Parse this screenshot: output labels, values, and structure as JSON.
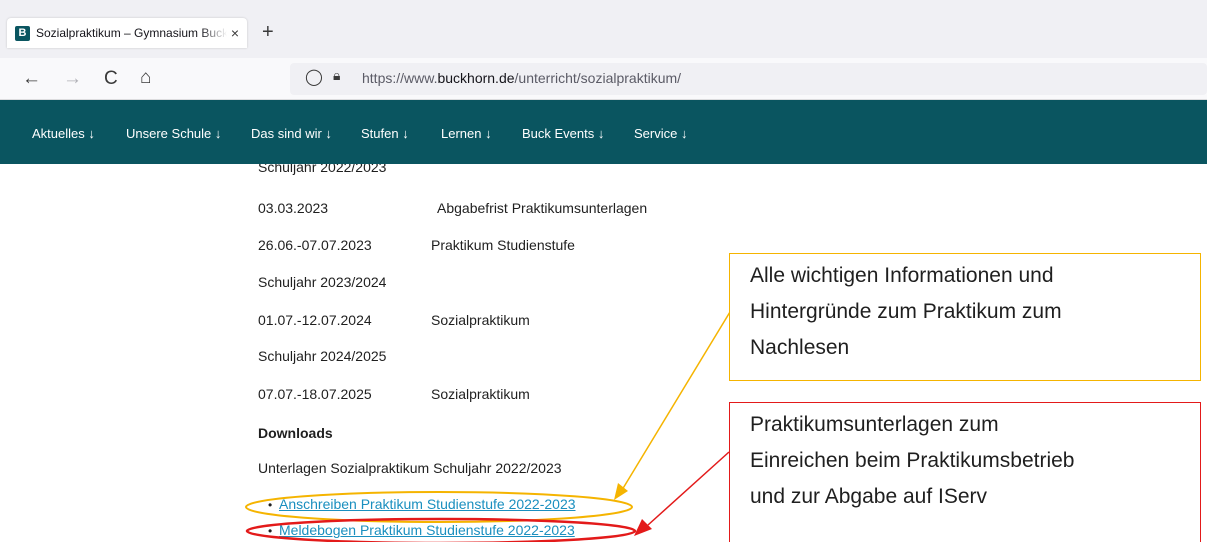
{
  "browser": {
    "tab_title": "Sozialpraktikum – Gymnasium Buckhorn",
    "favicon_letter": "B",
    "tab_close": "×",
    "new_tab": "+",
    "back_icon": "←",
    "forward_icon": "→",
    "reload_icon": "C",
    "home_icon": "⌂",
    "shield_icon": "◯",
    "lock_icon": "🔒︎",
    "url_prefix": "https://www.",
    "url_domain": "buckhorn.de",
    "url_path": "/unterricht/sozialpraktikum/"
  },
  "site_nav": {
    "items": [
      "Aktuelles ↓",
      "Unsere Schule ↓",
      "Das sind wir ↓",
      "Stufen ↓",
      "Lernen ↓",
      "Buck Events ↓",
      "Service ↓"
    ]
  },
  "content": {
    "partial_heading": "Schuljahr 2022/2023",
    "rows": [
      {
        "date": "03.03.2023",
        "text": "Abgabefrist Praktikumsunterlagen"
      },
      {
        "date": "26.06.-07.07.2023",
        "text": "Praktikum Studienstufe"
      },
      {
        "heading": "Schuljahr 2023/2024"
      },
      {
        "date": "01.07.-12.07.2024",
        "text": "Sozialpraktikum"
      },
      {
        "heading": "Schuljahr 2024/2025"
      },
      {
        "date": "07.07.-18.07.2025",
        "text": "Sozialpraktikum"
      }
    ],
    "downloads_heading": "Downloads",
    "downloads_subheading": "Unterlagen Sozialpraktikum Schuljahr 2022/2023",
    "links": [
      "Anschreiben Praktikum Studienstufe 2022-2023",
      "Meldebogen Praktikum Studienstufe 2022-2023"
    ]
  },
  "annotations": {
    "yellow_callout": [
      "Alle wichtigen Informationen und",
      "Hintergründe zum Praktikum zum",
      "Nachlesen"
    ],
    "red_callout": [
      "Praktikumsunterlagen zum",
      "Einreichen beim Praktikumsbetrieb",
      "und zur Abgabe auf IServ"
    ],
    "colors": {
      "yellow": "#f5b400",
      "red": "#e31a1a",
      "brand": "#0a5560",
      "link": "#1a8fbf"
    }
  }
}
